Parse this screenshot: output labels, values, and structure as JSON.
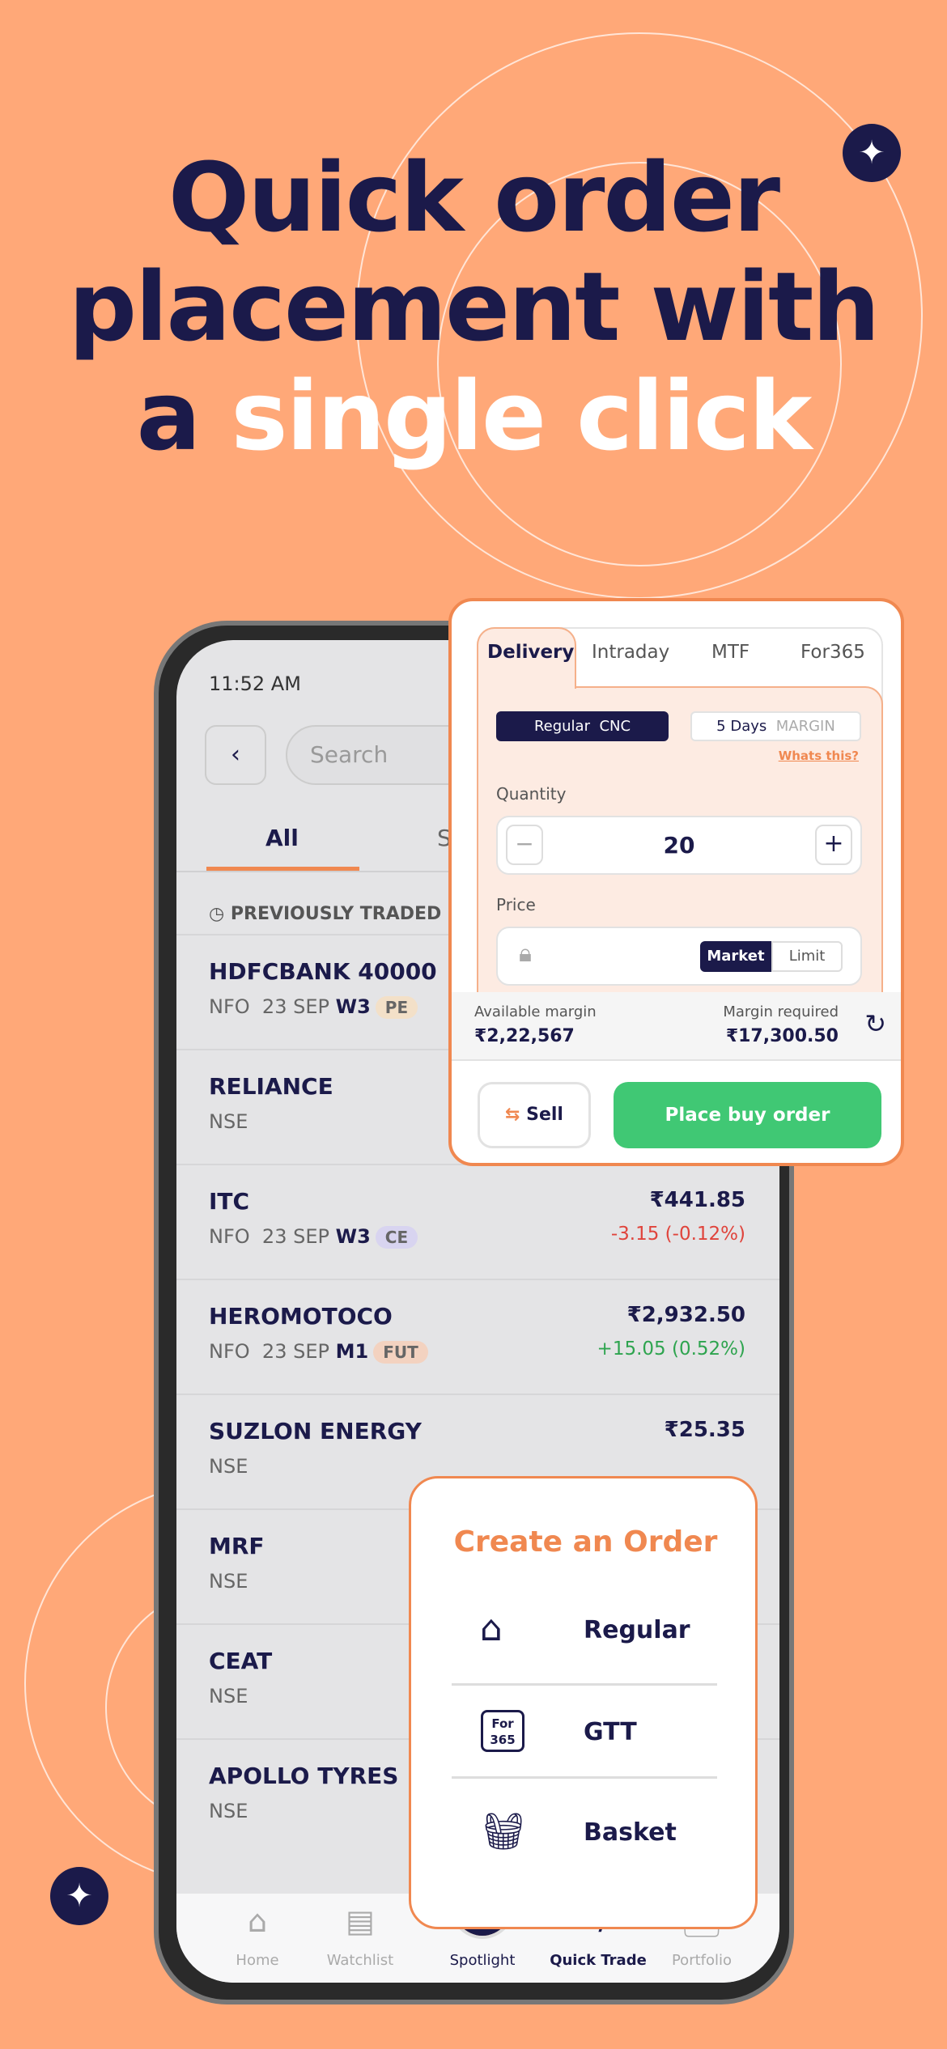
{
  "headline": {
    "line1": "Quick order",
    "line2": "placement with",
    "line3a": "a ",
    "line3b": "single click"
  },
  "status": {
    "time": "11:52 AM"
  },
  "search": {
    "placeholder": "Search"
  },
  "tabs": [
    "All",
    "S"
  ],
  "section": "PREVIOUSLY TRADED",
  "rows": [
    {
      "symbol": "HDFCBANK 40000",
      "exchange": "NFO",
      "expiry": "23 SEP",
      "week": "W3",
      "tag": "PE",
      "tag_color": "#f3e0c8",
      "price": "",
      "change": ""
    },
    {
      "symbol": "RELIANCE",
      "exchange": "NSE",
      "price": "",
      "change": ""
    },
    {
      "symbol": "ITC",
      "exchange": "NFO",
      "expiry": "23 SEP",
      "week": "W3",
      "tag": "CE",
      "tag_color": "#d8d4f0",
      "price": "₹441.85",
      "change": "-3.15 (-0.12%)",
      "dir": "down"
    },
    {
      "symbol": "HEROMOTOCO",
      "exchange": "NFO",
      "expiry": "23 SEP",
      "week": "M1",
      "tag": "FUT",
      "tag_color": "#f3d2c0",
      "price": "₹2,932.50",
      "change": "+15.05 (0.52%)",
      "dir": "up"
    },
    {
      "symbol": "SUZLON ENERGY",
      "exchange": "NSE",
      "price": "₹25.35",
      "change": ""
    },
    {
      "symbol": "MRF",
      "exchange": "NSE"
    },
    {
      "symbol": "CEAT",
      "exchange": "NSE"
    },
    {
      "symbol": "APOLLO TYRES",
      "exchange": "NSE"
    }
  ],
  "order": {
    "tabs": [
      "Delivery",
      "Intraday",
      "MTF",
      "For365"
    ],
    "regular": "Regular",
    "cnc": "CNC",
    "days": "5 Days",
    "margin": "MARGIN",
    "whats": "Whats this?",
    "qty_label": "Quantity",
    "qty": "20",
    "price_label": "Price",
    "market": "Market",
    "limit": "Limit",
    "avail_label": "Available margin",
    "avail": "₹2,22,567",
    "req_label": "Margin required",
    "req": "₹17,300.50",
    "sell": "Sell",
    "buy": "Place buy order"
  },
  "create": {
    "title": "Create an Order",
    "items": [
      "Regular",
      "GTT",
      "Basket"
    ],
    "gtt_icon_text": "For 365"
  },
  "nav": [
    "Home",
    "Watchlist",
    "Spotlight",
    "Quick Trade",
    "Portfolio"
  ],
  "colors": {
    "bg": "#ffa878",
    "navy": "#1b1a4a",
    "accent": "#f08850",
    "green": "#40c874",
    "red": "#e0443c",
    "up": "#2ea44f"
  }
}
